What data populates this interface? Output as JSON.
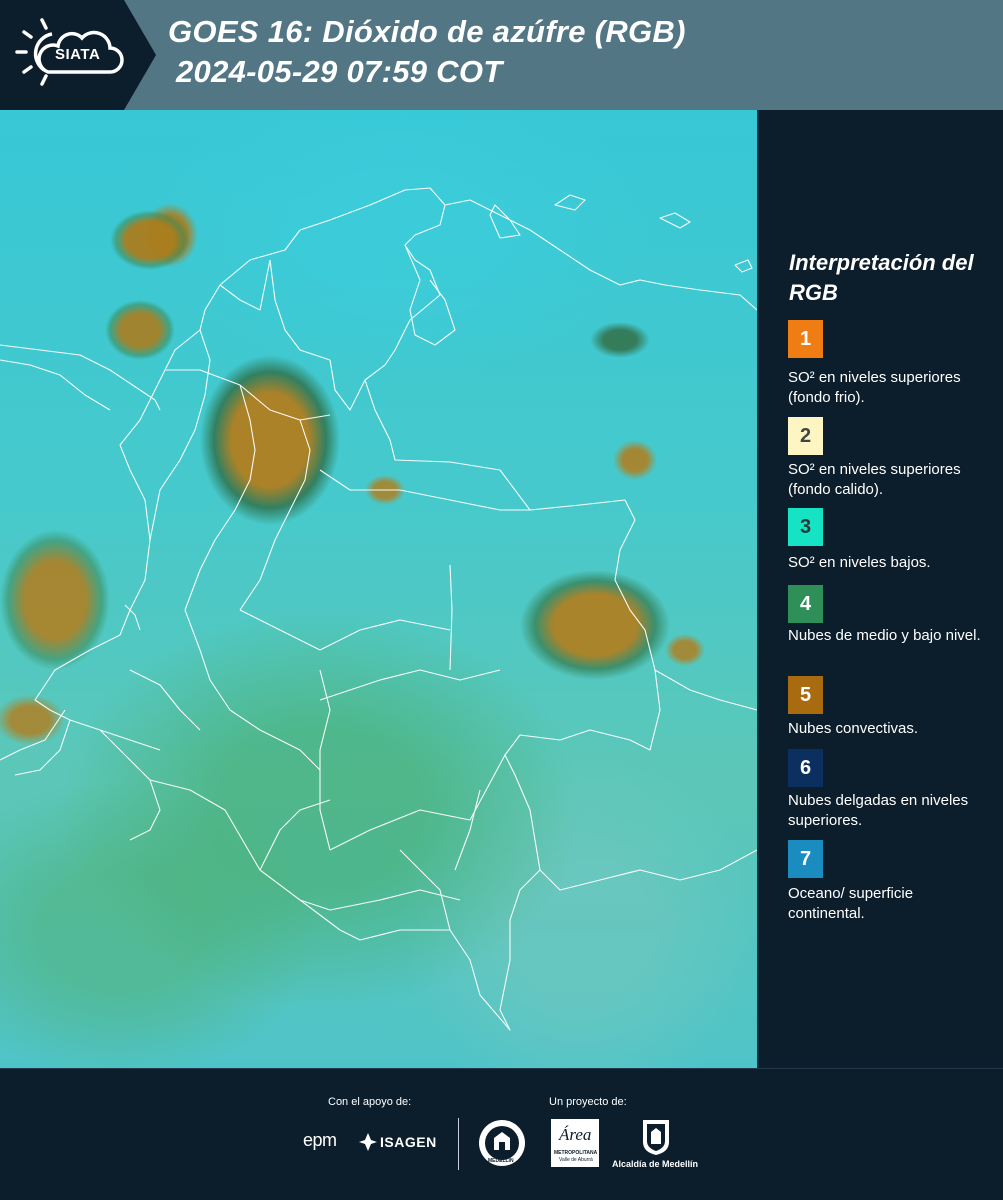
{
  "header": {
    "logo_text": "SIATA",
    "title_line1": "GOES 16: Dióxido de azúfre (RGB)",
    "title_line2": "2024-05-29 07:59 COT",
    "colors": {
      "logo_panel": "#0c1d2b",
      "title_bar": "#527684"
    }
  },
  "legend": {
    "title": "Interpretación del RGB",
    "items": [
      {
        "number": "1",
        "color": "#f07c14",
        "text_color": "#ffffff",
        "label": "SO² en niveles superiores (fondo frio)."
      },
      {
        "number": "2",
        "color": "#fdf6c3",
        "text_color": "#444444",
        "label": "SO² en niveles superiores (fondo calido)."
      },
      {
        "number": "3",
        "color": "#16e3c3",
        "text_color": "#1a3d3a",
        "label": "SO² en niveles bajos."
      },
      {
        "number": "4",
        "color": "#2f8f58",
        "text_color": "#ffffff",
        "label": "Nubes de medio y bajo nivel."
      },
      {
        "number": "5",
        "color": "#a86b10",
        "text_color": "#ffffff",
        "label": "Nubes convectivas."
      },
      {
        "number": "6",
        "color": "#0b3060",
        "text_color": "#ffffff",
        "label": "Nubes delgadas en niveles superiores."
      },
      {
        "number": "7",
        "color": "#1b8cc0",
        "text_color": "#ffffff",
        "label": "Oceano/ superficie continental."
      }
    ]
  },
  "footer": {
    "support_caption": "Con el apoyo de:",
    "project_caption": "Un proyecto de:",
    "epm_text": "epm",
    "isagen_text": "ISAGEN",
    "medellin_seal_text": "MEDELLÍN",
    "area_text": "Área",
    "area_subtitle": "METROPOLITANA",
    "area_subtitle2": "Valle de Aburrá",
    "alcaldia_text": "Alcaldía de Medellín"
  }
}
